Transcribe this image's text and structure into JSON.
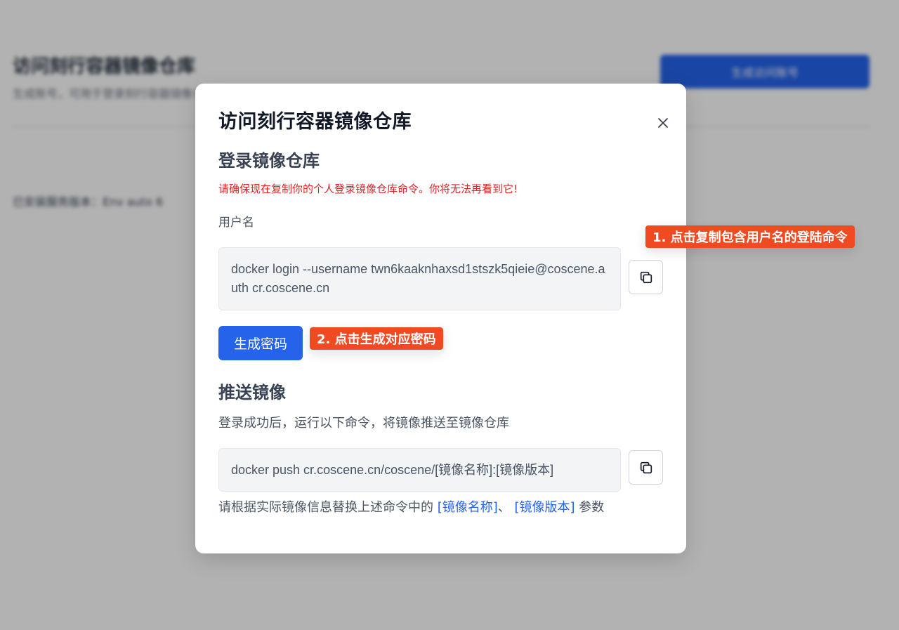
{
  "background": {
    "title": "访问刻行容器镜像仓库",
    "subtitle": "生成账号，可用于登录刻行容器镜像仓库",
    "button_label": "生成访问账号",
    "version_label": "已安装服务版本：Env  auto  6"
  },
  "modal": {
    "title": "访问刻行容器镜像仓库",
    "close_glyph": "×",
    "login_section": {
      "title": "登录镜像仓库",
      "warning": "请确保现在复制你的个人登录镜像仓库命令。你将无法再看到它!",
      "username_label": "用户名",
      "login_command": "docker login --username twn6kaaknhaxsd1stszk5qieie@coscene.auth cr.coscene.cn",
      "generate_password_label": "生成密码"
    },
    "push_section": {
      "title": "推送镜像",
      "description": "登录成功后，运行以下命令，将镜像推送至镜像仓库",
      "push_command": "docker push cr.coscene.cn/coscene/[镜像名称]:[镜像版本]",
      "hint_prefix": "请根据实际镜像信息替换上述命令中的 ",
      "hint_link_name": "[镜像名称]",
      "hint_separator": "、 ",
      "hint_link_version": "[镜像版本]",
      "hint_suffix": " 参数"
    }
  },
  "annotations": {
    "step1": "1. 点击复制包含用户名的登陆命令",
    "step2": "2. 点击生成对应密码"
  },
  "colors": {
    "primary": "#2563eb",
    "warning": "#dc2626",
    "callout": "#f04a23"
  },
  "icons": {
    "close": "close-icon",
    "copy": "copy-icon"
  }
}
